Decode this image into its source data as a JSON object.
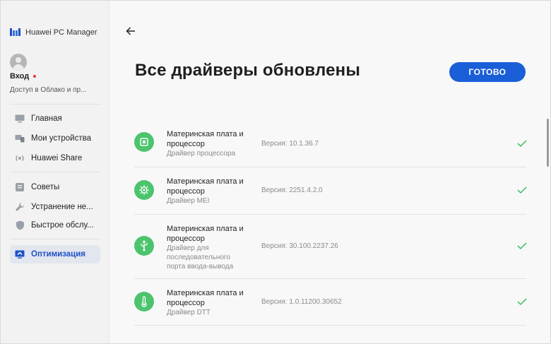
{
  "app": {
    "name": "Huawei PC Manager"
  },
  "user": {
    "login_label": "Вход",
    "cloud_access": "Доступ в Облако и пр..."
  },
  "sidebar": {
    "items": [
      {
        "label": "Главная",
        "icon": "monitor-icon"
      },
      {
        "label": "Мои устройства",
        "icon": "devices-icon"
      },
      {
        "label": "Huawei Share",
        "icon": "share-icon"
      },
      {
        "label": "Советы",
        "icon": "tips-icon"
      },
      {
        "label": "Устранение не...",
        "icon": "wrench-icon"
      },
      {
        "label": "Быстрое обслу...",
        "icon": "shield-icon"
      },
      {
        "label": "Оптимизация",
        "icon": "optimize-icon",
        "active": true
      }
    ]
  },
  "main": {
    "title": "Все драйверы обновлены",
    "done_button": "ГОТОВО",
    "drivers": [
      {
        "name": "Материнская плата и процессор",
        "desc": "Драйвер процессора",
        "version": "Версия: 10.1.36.7",
        "icon": "chip-icon"
      },
      {
        "name": "Материнская плата и процессор",
        "desc": "Драйвер MEI",
        "version": "Версия: 2251.4.2.0",
        "icon": "gear-chip-icon"
      },
      {
        "name": "Материнская плата и процессор",
        "desc": "Драйвер для последовательного порта ввода-вывода",
        "version": "Версия: 30.100.2237.26",
        "icon": "usb-icon"
      },
      {
        "name": "Материнская плата и процессор",
        "desc": "Драйвер DTT",
        "version": "Версия: 1.0.11200.30652",
        "icon": "thermometer-icon"
      }
    ]
  },
  "colors": {
    "accent": "#1a5ed8",
    "success": "#4cc46e",
    "alert": "#e23b3b"
  }
}
